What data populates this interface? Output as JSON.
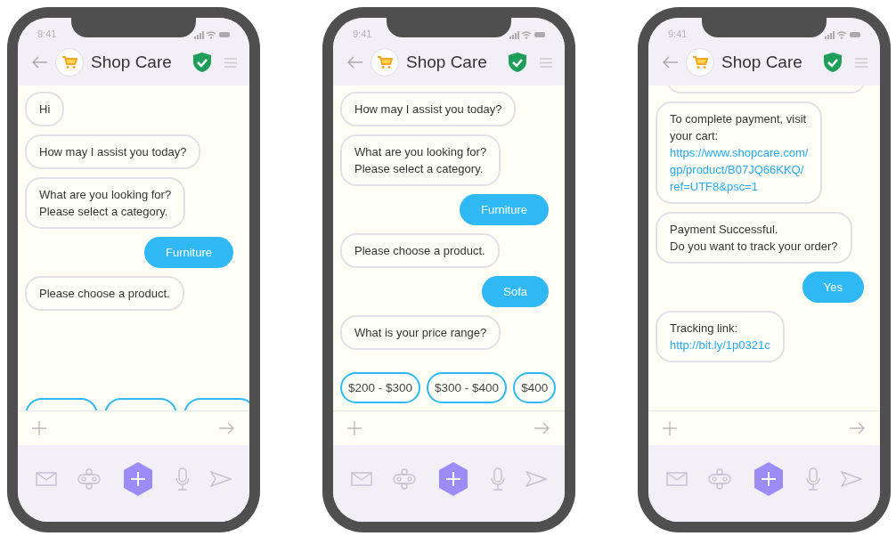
{
  "phones": [
    {
      "status_time": "9:41",
      "title": "Shop Care",
      "cut_bubble_top": false,
      "hidden_chips": true,
      "messages": [
        {
          "kind": "bot",
          "lines": [
            "Hi"
          ]
        },
        {
          "kind": "bot",
          "lines": [
            "How may I assist you today?"
          ]
        },
        {
          "kind": "bot",
          "lines": [
            "What are you looking for?",
            "Please select a category."
          ]
        },
        {
          "kind": "user",
          "lines": [
            "Furniture"
          ]
        },
        {
          "kind": "bot",
          "lines": [
            "Please choose a product."
          ]
        }
      ]
    },
    {
      "status_time": "9:41",
      "title": "Shop Care",
      "cut_bubble_top": false,
      "hidden_chips": false,
      "messages": [
        {
          "kind": "bot",
          "lines": [
            "How may I assist you today?"
          ]
        },
        {
          "kind": "bot",
          "lines": [
            "What are you looking for?",
            "Please select a category."
          ]
        },
        {
          "kind": "user",
          "lines": [
            "Furniture"
          ]
        },
        {
          "kind": "bot",
          "lines": [
            "Please choose a product."
          ]
        },
        {
          "kind": "user",
          "lines": [
            "Sofa"
          ]
        },
        {
          "kind": "bot",
          "lines": [
            "What is your price range?"
          ]
        }
      ],
      "chips": [
        "$200 - $300",
        "$300 - $400",
        "$400"
      ]
    },
    {
      "status_time": "9:41",
      "title": "Shop Care",
      "cut_bubble_top": true,
      "hidden_chips": false,
      "messages": [
        {
          "kind": "bot",
          "lines": [
            "To complete payment, visit",
            "your cart:"
          ],
          "link": [
            "https://www.shopcare.com/",
            "gp/product/B07JQ66KKQ/",
            "ref=UTF8&psc=1"
          ]
        },
        {
          "kind": "bot",
          "lines": [
            "Payment Successful.",
            "Do you want to track your order?"
          ]
        },
        {
          "kind": "user",
          "lines": [
            "Yes"
          ]
        },
        {
          "kind": "bot",
          "lines": [
            "Tracking link:"
          ],
          "link": [
            "http://bit.ly/1p0321c"
          ]
        }
      ]
    }
  ]
}
